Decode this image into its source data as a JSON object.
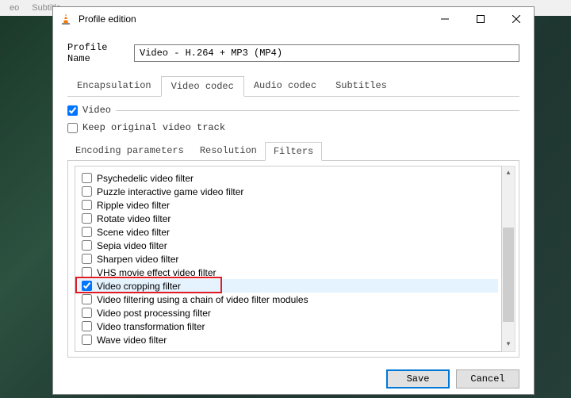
{
  "top_menu": {
    "item1": "eo",
    "item2": "Subtitle"
  },
  "dialog": {
    "title": "Profile edition",
    "profile_label": "Profile Name",
    "profile_value": "Video - H.264 + MP3 (MP4)",
    "main_tabs": {
      "encapsulation": "Encapsulation",
      "video_codec": "Video codec",
      "audio_codec": "Audio codec",
      "subtitles": "Subtitles"
    },
    "video_group": "Video",
    "keep_original": "Keep original video track",
    "sub_tabs": {
      "encoding": "Encoding parameters",
      "resolution": "Resolution",
      "filters": "Filters"
    },
    "filters": [
      {
        "label": "Psychedelic video filter",
        "checked": false
      },
      {
        "label": "Puzzle interactive game video filter",
        "checked": false
      },
      {
        "label": "Ripple video filter",
        "checked": false
      },
      {
        "label": "Rotate video filter",
        "checked": false
      },
      {
        "label": "Scene video filter",
        "checked": false
      },
      {
        "label": "Sepia video filter",
        "checked": false
      },
      {
        "label": "Sharpen video filter",
        "checked": false
      },
      {
        "label": "VHS movie effect video filter",
        "checked": false
      },
      {
        "label": "Video cropping filter",
        "checked": true
      },
      {
        "label": "Video filtering using a chain of video filter modules",
        "checked": false
      },
      {
        "label": "Video post processing filter",
        "checked": false
      },
      {
        "label": "Video transformation filter",
        "checked": false
      },
      {
        "label": "Wave video filter",
        "checked": false
      }
    ],
    "selected_index": 8,
    "highlight_index": 8,
    "buttons": {
      "save": "Save",
      "cancel": "Cancel"
    }
  }
}
